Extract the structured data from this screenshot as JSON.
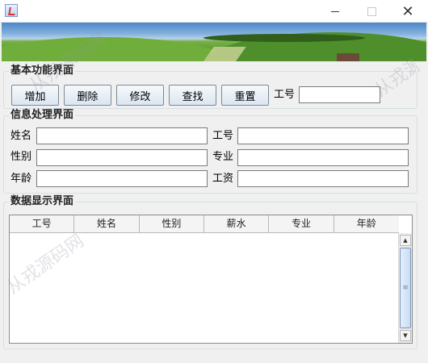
{
  "window": {
    "title": "",
    "minimize_icon": "minimize-icon",
    "maximize_icon": "maximize-icon",
    "close_glyph": "✕"
  },
  "watermark": "从戎源码网",
  "basic_panel": {
    "legend": "基本功能界面",
    "buttons": {
      "add": "增加",
      "delete": "删除",
      "edit": "修改",
      "search": "查找",
      "reset": "重置"
    },
    "id_label": "工号",
    "id_value": ""
  },
  "info_panel": {
    "legend": "信息处理界面",
    "fields": {
      "name_label": "姓名",
      "name_value": "",
      "gender_label": "性别",
      "gender_value": "",
      "age_label": "年龄",
      "age_value": "",
      "id_label": "工号",
      "id_value": "",
      "major_label": "专业",
      "major_value": "",
      "salary_label": "工资",
      "salary_value": ""
    }
  },
  "display_panel": {
    "legend": "数据显示界面",
    "columns": [
      "工号",
      "姓名",
      "性别",
      "薪水",
      "专业",
      "年龄"
    ],
    "rows": []
  },
  "colors": {
    "window_bg": "#f0f0f0",
    "button_border": "#7a8a99",
    "group_border": "#d5dfe5"
  }
}
